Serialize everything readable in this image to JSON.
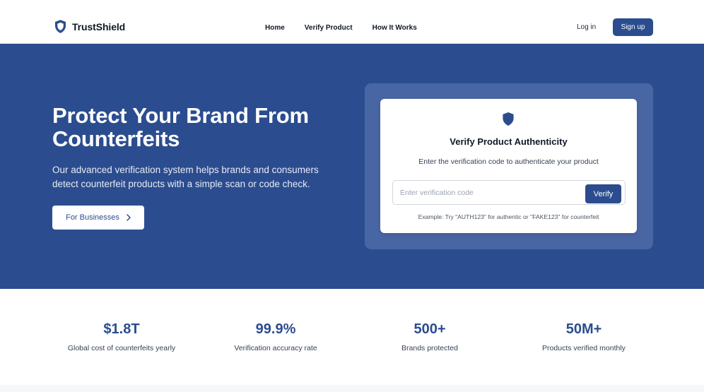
{
  "brand": {
    "name": "TrustShield",
    "logo_icon": "shield-icon"
  },
  "nav": {
    "items": [
      {
        "label": "Home"
      },
      {
        "label": "Verify Product"
      },
      {
        "label": "How It Works"
      }
    ]
  },
  "auth": {
    "login_label": "Log in",
    "signup_label": "Sign up"
  },
  "hero": {
    "title": "Protect Your Brand From Counterfeits",
    "description": "Our advanced verification system helps brands and consumers detect counterfeit products with a simple scan or code check.",
    "cta_label": "For Businesses",
    "cta_icon": "chevron-right-icon"
  },
  "verify_card": {
    "icon": "shield-icon",
    "title": "Verify Product Authenticity",
    "subtitle": "Enter the verification code to authenticate your product",
    "input_value": "",
    "input_placeholder": "Enter verification code",
    "button_label": "Verify",
    "example": "Example: Try \"AUTH123\" for authentic or \"FAKE123\" for counterfeit"
  },
  "stats": [
    {
      "value": "$1.8T",
      "label": "Global cost of counterfeits yearly"
    },
    {
      "value": "99.9%",
      "label": "Verification accuracy rate"
    },
    {
      "value": "500+",
      "label": "Brands protected"
    },
    {
      "value": "50M+",
      "label": "Products verified monthly"
    }
  ],
  "colors": {
    "primary": "#2b4d8f",
    "card_outer": "#4966a4",
    "white": "#ffffff",
    "text_dark": "#111827"
  }
}
